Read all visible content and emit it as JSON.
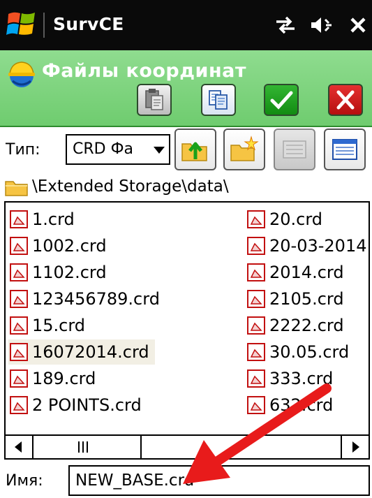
{
  "taskbar": {
    "app_title": "SurvCE"
  },
  "header": {
    "title": "Файлы координат"
  },
  "type_row": {
    "label": "Тип:",
    "selected": "CRD Фа"
  },
  "path": "\\Extended Storage\\data\\",
  "files": {
    "left": [
      "1.crd",
      "1002.crd",
      "1102.crd",
      "123456789.crd",
      "15.crd",
      "16072014.crd",
      "189.crd",
      "2 POINTS.crd"
    ],
    "right": [
      "20.crd",
      "20-03-2014",
      "2014.crd",
      "2105.crd",
      "2222.crd",
      "30.05.crd",
      "333.crd",
      "632.crd"
    ]
  },
  "name_row": {
    "label": "Имя:",
    "value": "NEW_BASE.crd"
  },
  "colors": {
    "header_green": "#7fd47f",
    "ok_green": "#1ea01e",
    "cancel_red": "#cc1a1a",
    "arrow_red": "#e81b1b"
  }
}
